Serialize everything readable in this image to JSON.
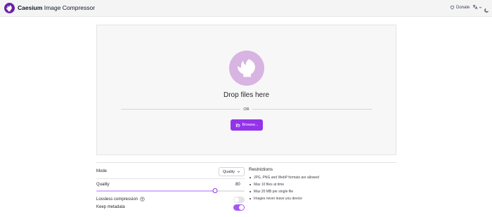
{
  "header": {
    "title_bold": "Caesium",
    "title_rest": " Image Compressor",
    "donate_label": "Donate"
  },
  "drop_zone": {
    "title": "Drop files here",
    "or_text": "OR",
    "browse_label": "Browse..."
  },
  "settings": {
    "mode_label": "Mode",
    "mode_value": "Quality",
    "quality_label": "Quality",
    "quality_value": "80",
    "quality_level": 0.8,
    "lossless_label": "Lossless compression",
    "lossless_on": false,
    "metadata_label": "Keep metadata",
    "metadata_on": true
  },
  "restrictions": {
    "title": "Restrictions",
    "items": [
      "JPG, PNG and WebP formats are allowed",
      "Max 10 files at time",
      "Max 20 MB per single file",
      "Images never leave you device"
    ]
  },
  "colors": {
    "accent": "#9333ea",
    "accent_light": "#d8b4e2"
  }
}
